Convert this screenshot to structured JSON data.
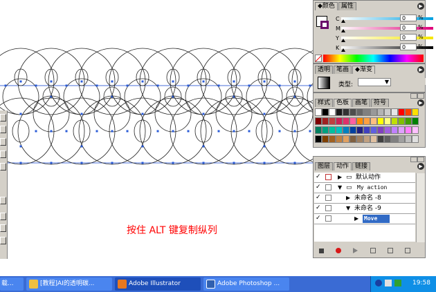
{
  "colors": {
    "accent": "#316ac5",
    "caption": "#ff0000",
    "guide": "#4a6fd9",
    "handle": "#2a5bd7"
  },
  "caption": "按住 ALT 键复制纵列",
  "color_panel": {
    "tabs": [
      "◆颜色",
      "属性"
    ],
    "sliders": [
      {
        "label": "C",
        "value": "0",
        "unit": "%"
      },
      {
        "label": "M",
        "value": "0",
        "unit": "%"
      },
      {
        "label": "Y",
        "value": "0",
        "unit": "%"
      },
      {
        "label": "K",
        "value": "0",
        "unit": "%"
      }
    ]
  },
  "gradient_panel": {
    "tabs": [
      "透明",
      "笔画",
      "◆渐变"
    ],
    "type_label": "类型:"
  },
  "swatch_panel": {
    "tabs": [
      "样式",
      "色板",
      "画笔",
      "符号"
    ]
  },
  "layers_panel": {
    "tabs": [
      "图层",
      "动作",
      "链接"
    ],
    "items": [
      {
        "label": "默认动作",
        "level": 0,
        "expanded": false,
        "folder": true
      },
      {
        "label": "My action",
        "level": 0,
        "expanded": true,
        "folder": true
      },
      {
        "label": "未命名 -8",
        "level": 1,
        "expanded": false,
        "folder": false
      },
      {
        "label": "未命名 -9",
        "level": 1,
        "expanded": true,
        "folder": false
      },
      {
        "label": "Move",
        "level": 2,
        "expanded": false,
        "folder": false,
        "selected": true
      }
    ]
  },
  "taskbar": {
    "tasks": [
      {
        "label": "载..."
      },
      {
        "label": "[教程]AI的透明碳..."
      },
      {
        "label": "Adobe Illustrator"
      },
      {
        "label": "Adobe Photoshop ..."
      }
    ],
    "clock": "19:58"
  }
}
